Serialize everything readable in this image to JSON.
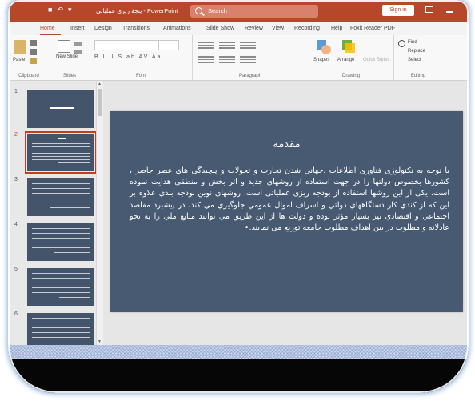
{
  "window": {
    "title": "پنجهٔ ریزی عملیاتی - PowerPoint",
    "search_label": "Search",
    "signin_label": "Sign in",
    "accent_color": "#b7472a"
  },
  "ribbon_tabs": [
    "Home",
    "Insert",
    "Design",
    "Transitions",
    "Animations",
    "Slide Show",
    "Review",
    "View",
    "Recording",
    "Help",
    "Foxit Reader PDF"
  ],
  "ribbon": {
    "clipboard": {
      "label": "Clipboard",
      "paste": "Paste"
    },
    "slides": {
      "label": "Slides",
      "new_slide": "New Slide"
    },
    "font": {
      "label": "Font",
      "format_row": "B I U S ab AV Aa"
    },
    "paragraph": {
      "label": "Paragraph"
    },
    "drawing": {
      "label": "Drawing",
      "shapes": "Shapes",
      "arrange": "Arrange",
      "quick_styles": "Quick Styles"
    },
    "editing": {
      "label": "Editing",
      "find": "Find",
      "replace": "Replace",
      "select": "Select"
    }
  },
  "thumbnails": [
    {
      "num": "1",
      "selected": false
    },
    {
      "num": "2",
      "selected": true
    },
    {
      "num": "3",
      "selected": false
    },
    {
      "num": "4",
      "selected": false
    },
    {
      "num": "5",
      "selected": false
    },
    {
      "num": "6",
      "selected": false
    }
  ],
  "slide": {
    "background": "#475a72",
    "title": "مقدمه",
    "body": "با توجه به تکنولوژی فناوری اطلاعات ،جهانی شدن تجارت و تحولات و پیچیدگی هاي عصر حاضر ، کشورها بخصوص دولتها را در جهت استفاده از روشهای جدید و اثر بخش و منطقی هدایت نموده است. یکی از این روشها استفاده از بودجه ریزی عملیاتی است. روشهای نوین بودجه بندي علاوه بر این که از کندي کار دستگاههاي دولتي و اسراف اموال عمومي جلوگيري مي کند، در پيشبرد مقاصد اجتماعي و اقتصادي نيز بسيار مؤثر بوده و دولت ها از اين طريق مي توانند منابع ملي را به نحو عادلانه و مطلوب در بين اهداف مطلوب جامعه توزيع مي نمايند."
  }
}
